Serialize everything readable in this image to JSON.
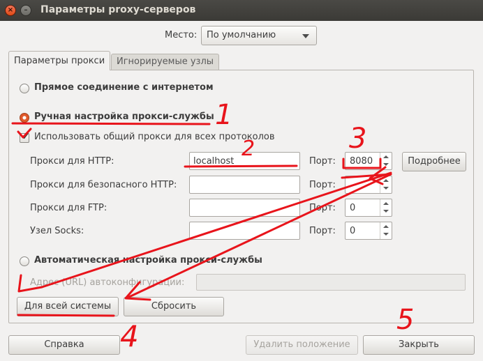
{
  "window": {
    "title": "Параметры proxy-серверов",
    "close_glyph": "×",
    "minimize_glyph": "–"
  },
  "location": {
    "label": "Место:",
    "value": "По умолчанию"
  },
  "tabs": [
    {
      "label": "Параметры прокси",
      "active": true
    },
    {
      "label": "Игнорируемые узлы",
      "active": false
    }
  ],
  "proxy": {
    "direct": "Прямое соединение с интернетом",
    "manual": "Ручная настройка прокси-службы",
    "use_same": "Использовать общий прокси для всех протоколов",
    "port_label": "Порт:",
    "http": {
      "label": "Прокси для HTTP:",
      "value": "localhost",
      "port": "8080"
    },
    "https": {
      "label": "Прокси для безопасного HTTP:",
      "value": "",
      "port": ""
    },
    "ftp": {
      "label": "Прокси для FTP:",
      "value": "",
      "port": "0"
    },
    "socks": {
      "label": "Узел Socks:",
      "value": "",
      "port": "0"
    },
    "details_button": "Подробнее",
    "auto": "Автоматическая настройка прокси-службы",
    "auto_url_label": "Адрес (URL) автоконфигурации:",
    "apply_system": "Для всей системы",
    "reset": "Сбросить"
  },
  "footer": {
    "help": "Справка",
    "delete_location": "Удалить положение",
    "close": "Закрыть"
  },
  "annotations": {
    "numbers": [
      "1",
      "2",
      "3",
      "4",
      "5"
    ],
    "color": "#e8141b"
  },
  "colors": {
    "titlebar": "#3c3b37",
    "radio_selected": "#e0592a",
    "background": "#f2f1f0"
  }
}
